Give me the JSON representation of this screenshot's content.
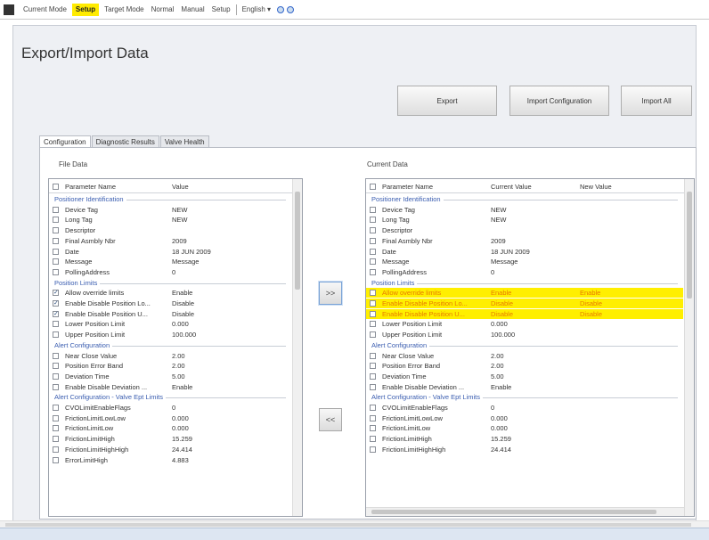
{
  "topbar": {
    "items": [
      "Current Mode",
      "Setup",
      "Target Mode",
      "Normal",
      "Manual",
      "Setup",
      "English ▾"
    ]
  },
  "page": {
    "title": "Export/Import Data"
  },
  "buttons": {
    "export": "Export",
    "import_config": "Import Configuration",
    "import_all": "Import All"
  },
  "tabs": [
    "Configuration",
    "Diagnostic Results",
    "Valve Health"
  ],
  "left": {
    "label": "File Data",
    "headers": [
      "Parameter Name",
      "Value"
    ],
    "rows": [
      {
        "t": "sec",
        "name": "Positioner Identification"
      },
      {
        "name": "Device Tag",
        "value": "NEW",
        "chk": false
      },
      {
        "name": "Long Tag",
        "value": "NEW",
        "chk": false
      },
      {
        "name": "Descriptor",
        "value": "",
        "chk": false
      },
      {
        "name": "Final Asmbly Nbr",
        "value": "2009",
        "chk": false
      },
      {
        "name": "Date",
        "value": "18 JUN 2009",
        "chk": false
      },
      {
        "name": "Message",
        "value": "Message",
        "chk": false
      },
      {
        "name": "PollingAddress",
        "value": "0",
        "chk": false
      },
      {
        "t": "sec",
        "name": "Position Limits"
      },
      {
        "name": "Allow override limits",
        "value": "Enable",
        "chk": true
      },
      {
        "name": "Enable Disable Position Lo...",
        "value": "Disable",
        "chk": true
      },
      {
        "name": "Enable Disable Position U...",
        "value": "Disable",
        "chk": true
      },
      {
        "name": "Lower Position Limit",
        "value": "0.000",
        "chk": false
      },
      {
        "name": "Upper Position Limit",
        "value": "100.000",
        "chk": false
      },
      {
        "t": "sec",
        "name": "Alert Configuration"
      },
      {
        "name": "Near Close Value",
        "value": "2.00",
        "chk": false
      },
      {
        "name": "Position Error Band",
        "value": "2.00",
        "chk": false
      },
      {
        "name": "Deviation Time",
        "value": "5.00",
        "chk": false
      },
      {
        "name": "Enable Disable Deviation ...",
        "value": "Enable",
        "chk": false
      },
      {
        "t": "sec",
        "name": "Alert Configuration - Valve Ept Limits"
      },
      {
        "name": "CVOLimitEnableFlags",
        "value": "0",
        "chk": false
      },
      {
        "name": "FrictionLimitLowLow",
        "value": "0.000",
        "chk": false
      },
      {
        "name": "FrictionLimitLow",
        "value": "0.000",
        "chk": false
      },
      {
        "name": "FrictionLimitHigh",
        "value": "15.259",
        "chk": false
      },
      {
        "name": "FrictionLimitHighHigh",
        "value": "24.414",
        "chk": false
      },
      {
        "name": "ErrorLimitHigh",
        "value": "4.883",
        "chk": false
      }
    ]
  },
  "right": {
    "label": "Current Data",
    "headers": [
      "Parameter Name",
      "Current Value",
      "New Value"
    ],
    "rows": [
      {
        "t": "sec",
        "name": "Positioner Identification"
      },
      {
        "name": "Device Tag",
        "value": "NEW",
        "nv": ""
      },
      {
        "name": "Long Tag",
        "value": "NEW",
        "nv": ""
      },
      {
        "name": "Descriptor",
        "value": "",
        "nv": ""
      },
      {
        "name": "Final Asmbly Nbr",
        "value": "2009",
        "nv": ""
      },
      {
        "name": "Date",
        "value": "18 JUN 2009",
        "nv": ""
      },
      {
        "name": "Message",
        "value": "Message",
        "nv": ""
      },
      {
        "name": "PollingAddress",
        "value": "0",
        "nv": ""
      },
      {
        "t": "sec",
        "name": "Position Limits"
      },
      {
        "name": "Allow override limits",
        "value": "Enable",
        "nv": "Enable",
        "hi": true
      },
      {
        "name": "Enable Disable Position Lo...",
        "value": "Disable",
        "nv": "Disable",
        "hi": true
      },
      {
        "name": "Enable Disable Position U...",
        "value": "Disable",
        "nv": "Disable",
        "hi": true
      },
      {
        "name": "Lower Position Limit",
        "value": "0.000",
        "nv": ""
      },
      {
        "name": "Upper Position Limit",
        "value": "100.000",
        "nv": ""
      },
      {
        "t": "sec",
        "name": "Alert Configuration"
      },
      {
        "name": "Near Close Value",
        "value": "2.00",
        "nv": ""
      },
      {
        "name": "Position Error Band",
        "value": "2.00",
        "nv": ""
      },
      {
        "name": "Deviation Time",
        "value": "5.00",
        "nv": ""
      },
      {
        "name": "Enable Disable Deviation ...",
        "value": "Enable",
        "nv": ""
      },
      {
        "t": "sec",
        "name": "Alert Configuration - Valve Ept Limits"
      },
      {
        "name": "CVOLimitEnableFlags",
        "value": "0",
        "nv": ""
      },
      {
        "name": "FrictionLimitLowLow",
        "value": "0.000",
        "nv": ""
      },
      {
        "name": "FrictionLimitLow",
        "value": "0.000",
        "nv": ""
      },
      {
        "name": "FrictionLimitHigh",
        "value": "15.259",
        "nv": ""
      },
      {
        "name": "FrictionLimitHighHigh",
        "value": "24.414",
        "nv": ""
      }
    ]
  },
  "transfer": {
    "right": ">>",
    "left": "<<"
  },
  "colors": {
    "highlight": "#ffef00",
    "highlight_text": "#e87a00",
    "section": "#3a5db0",
    "selected_mode": "#ffeb00"
  }
}
